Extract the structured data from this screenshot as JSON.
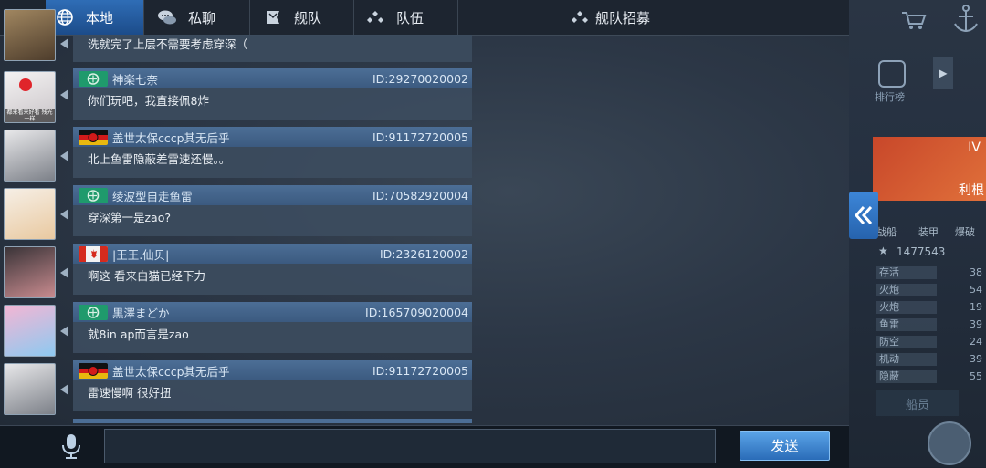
{
  "tabs": [
    {
      "label": "本地",
      "icon": "globe-icon"
    },
    {
      "label": "私聊",
      "icon": "chat-bubbles-icon"
    },
    {
      "label": "舰队",
      "icon": "fleet-flag-icon"
    },
    {
      "label": "队伍",
      "icon": "team-dots-icon"
    },
    {
      "label": "舰队招募",
      "icon": "recruit-dots-icon"
    }
  ],
  "messages": [
    {
      "name": "",
      "id": "",
      "text": "洗就完了上层不需要考虑穿深（",
      "flag": "none"
    },
    {
      "name": "神楽七奈",
      "id": "ID:29270020002",
      "text": "你们玩吧，我直接佩8炸",
      "flag": "green"
    },
    {
      "name": "盖世太保cccp其无后乎",
      "id": "ID:91172720005",
      "text": "北上鱼雷隐蔽差雷速还慢。。",
      "flag": "germany"
    },
    {
      "name": "绫波型自走鱼雷",
      "id": "ID:70582920004",
      "text": "穿深第一是zao?",
      "flag": "green"
    },
    {
      "name": "|王王.仙贝|",
      "id": "ID:2326120002",
      "text": "啊这 看来白猫已经下力",
      "flag": "canada"
    },
    {
      "name": "黒澤まどか",
      "id": "ID:165709020004",
      "text": "就8in ap而言是zao",
      "flag": "green"
    },
    {
      "name": "盖世太保cccp其无后乎",
      "id": "ID:91172720005",
      "text": "雷速慢啊 很好扭",
      "flag": "germany"
    }
  ],
  "avatars": [
    {
      "name": "avatar-mech"
    },
    {
      "name": "avatar-white-hair-girl",
      "caption": "都来看来好看 残光一样"
    },
    {
      "name": "avatar-armored-girl"
    },
    {
      "name": "avatar-bunny-girl"
    },
    {
      "name": "avatar-dark-hair-girl"
    },
    {
      "name": "avatar-pink-hair-girl"
    },
    {
      "name": "avatar-armored-girl-2"
    }
  ],
  "input": {
    "value": "",
    "placeholder": ""
  },
  "send_label": "发送",
  "side_panel": {
    "rank_label": "排行榜",
    "tier": "IV",
    "tier_text": "利根",
    "buttons": [
      "战船",
      "装甲",
      "爆破"
    ],
    "rating": "1477543",
    "stats": [
      {
        "label": "存活",
        "value": "38"
      },
      {
        "label": "火炮",
        "value": "54"
      },
      {
        "label": "火炮",
        "value": "19"
      },
      {
        "label": "鱼雷",
        "value": "39"
      },
      {
        "label": "防空",
        "value": "24"
      },
      {
        "label": "机动",
        "value": "39"
      },
      {
        "label": "隐蔽",
        "value": "55"
      }
    ],
    "crew_label": "船员"
  },
  "colors": {
    "tab_active": "#2f6db6",
    "msg_header": "#4c6e96",
    "msg_body": "#3c4c5e",
    "send_button": "#3a82d0"
  }
}
